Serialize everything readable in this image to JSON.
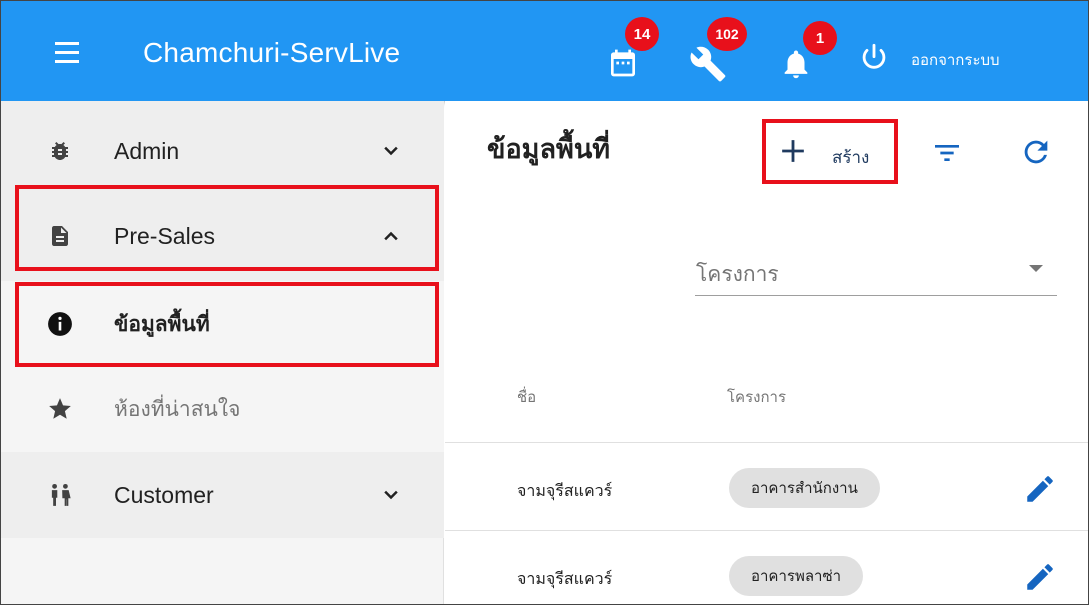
{
  "header": {
    "title": "Chamchuri-ServLive",
    "calendar_badge": "14",
    "tools_badge": "102",
    "notification_badge": "1",
    "logout_label": "ออกจากระบบ",
    "bar_color": "#2196f3",
    "badge_color": "#e8101b"
  },
  "sidebar": {
    "items": [
      {
        "label": "Admin",
        "icon": "bug-icon",
        "expanded": false
      },
      {
        "label": "Pre-Sales",
        "icon": "document-icon",
        "expanded": true
      },
      {
        "label": "ข้อมูลพื้นที่",
        "icon": "info-icon",
        "active": true
      },
      {
        "label": "ห้องที่น่าสนใจ",
        "icon": "star-icon"
      },
      {
        "label": "Customer",
        "icon": "people-icon",
        "expanded": false
      }
    ]
  },
  "main": {
    "title": "ข้อมูลพื้นที่",
    "create_label": "สร้าง",
    "project_select": {
      "placeholder": "โครงการ"
    },
    "table": {
      "columns": [
        "ชื่อ",
        "โครงการ"
      ],
      "rows": [
        {
          "name": "จามจุรีสแควร์",
          "project": "อาคารสำนักงาน"
        },
        {
          "name": "จามจุรีสแควร์",
          "project": "อาคารพลาซ่า"
        }
      ]
    }
  },
  "highlight_color": "#e8101b"
}
